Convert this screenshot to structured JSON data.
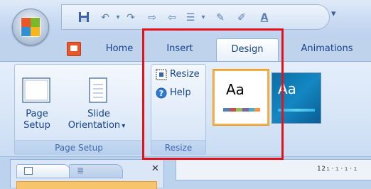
{
  "tabs": [
    {
      "label": "Home",
      "active": false
    },
    {
      "label": "Insert",
      "active": false
    },
    {
      "label": "Design",
      "active": true
    },
    {
      "label": "Animations",
      "active": false
    }
  ],
  "groups": {
    "page_setup": {
      "label": "Page Setup",
      "buttons": [
        {
          "line1": "Page",
          "line2": "Setup"
        },
        {
          "line1": "Slide",
          "line2": "Orientation"
        }
      ]
    },
    "resize": {
      "label": "Resize",
      "buttons": [
        {
          "label": "Resize",
          "icon": "resize-icon"
        },
        {
          "label": "Help",
          "icon": "help-icon"
        }
      ]
    },
    "themes": {
      "samples": [
        {
          "text": "Aa",
          "selected": true
        },
        {
          "text": "Aa",
          "selected": false
        }
      ]
    }
  },
  "ruler_text": "12",
  "colors": {
    "accent_frame": "#e3121b",
    "tab_text": "#15428b",
    "theme_selected_border": "#f3b24a"
  }
}
